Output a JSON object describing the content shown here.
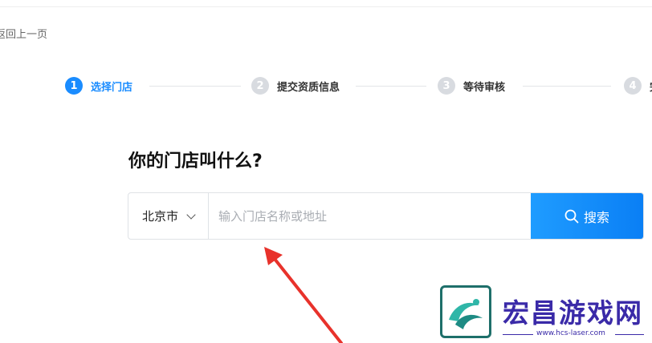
{
  "nav": {
    "back_label": "返回上一页"
  },
  "steps": [
    {
      "number": "1",
      "label": "选择门店",
      "active": true
    },
    {
      "number": "2",
      "label": "提交资质信息",
      "active": false
    },
    {
      "number": "3",
      "label": "等待审核",
      "active": false
    },
    {
      "number": "4",
      "label": "完",
      "active": false
    }
  ],
  "main": {
    "question": "你的门店叫什么?"
  },
  "search": {
    "city_value": "北京市",
    "placeholder": "输入门店名称或地址",
    "button_label": "搜索"
  },
  "watermark": {
    "brand": "宏昌游戏网",
    "url": "www.hcs-laser.com"
  },
  "colors": {
    "accent": "#1a8cff",
    "annotation_arrow": "#e8322b",
    "watermark": "#3a2aa8"
  }
}
